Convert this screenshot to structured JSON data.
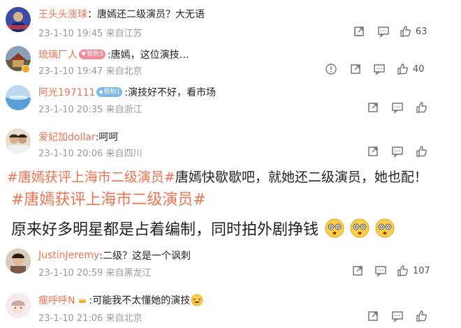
{
  "comments": [
    {
      "username": "王头头涨球",
      "separator": "：",
      "text": "唐嫣还二级演员？大无语",
      "time": "23-1-10 19:45",
      "location": "来自江苏",
      "likes": "63",
      "fan_badge": "",
      "avatar_color": "#3a4ca8"
    },
    {
      "username": "琉璃厂人",
      "separator": "",
      "text": ":唐嫣，这位演技…",
      "time": "23-1-10 19:47",
      "location": "来自北京",
      "likes": "40",
      "fan_badge": "铁粉5",
      "fan_badge_color": "#f08a9a",
      "verified": true,
      "avatar_color": "#6b5a3a"
    },
    {
      "username": "阿光197111",
      "separator": "",
      "text": ":演技好不好，看市场",
      "time": "23-1-10 20:35",
      "location": "来自浙江",
      "likes": "",
      "fan_badge": "铁粉1",
      "fan_badge_color": "#7db8e8",
      "avatar_color": "#5aa0d8"
    },
    {
      "username": "爱妃加dollar",
      "separator": "",
      "text": ":呵呵",
      "time": "23-1-10 20:06",
      "location": "来自四川",
      "likes": "",
      "fan_badge": "",
      "avatar_color": "#b09070"
    }
  ],
  "post_text": {
    "hashtag1": "#唐嫣获评上海市二级演员#",
    "line1_rest": "唐嫣快歇歇吧，就她还二级演员，她也配！",
    "hashtag2": "#唐嫣获评上海市二级演员#",
    "line3": "原来好多明星都是占着编制，同时拍外剧挣钱"
  },
  "comments_lower": [
    {
      "username": "JustinJeremy",
      "separator": "",
      "text": ":二级？这是一个讽刺",
      "time": "23-1-10 20:59",
      "location": "来自黑龙江",
      "likes": "107",
      "fan_badge": "",
      "avatar_color": "#c0a080"
    },
    {
      "username": "瘦呼呼N",
      "separator": "",
      "text": ":可能我不太懂她的演技",
      "time": "23-1-10 21:06",
      "location": "来自北京",
      "likes": "",
      "fan_badge": "",
      "avatar_color": "#e8d0d0"
    }
  ],
  "icons": {
    "share": "share-icon",
    "comment": "comment-icon",
    "like": "thumbs-up-icon",
    "report": "warning-icon",
    "dizzy_emoji": "dizzy-face-emoji",
    "laugh_emoji": "laughing-emoji"
  },
  "colors": {
    "username": "#eb7350",
    "meta": "#9a9a9a"
  }
}
